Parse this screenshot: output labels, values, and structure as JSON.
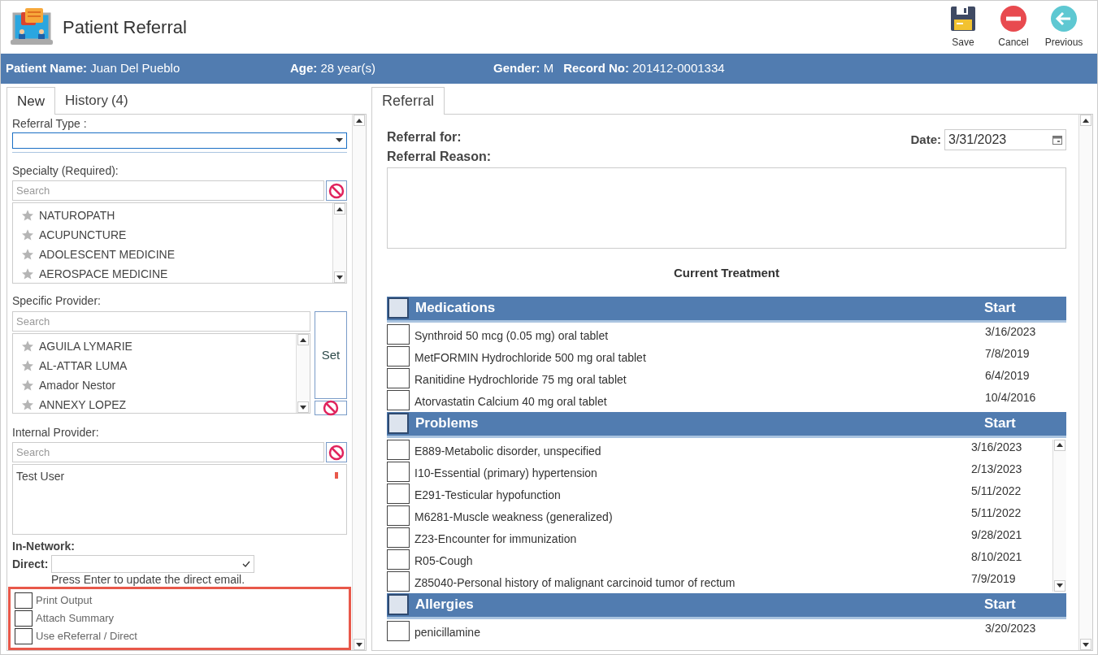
{
  "window": {
    "title": "Patient Referral"
  },
  "toolbar": [
    {
      "kind": "save",
      "label": "Save"
    },
    {
      "kind": "cancel",
      "label": "Cancel"
    },
    {
      "kind": "previous",
      "label": "Previous"
    }
  ],
  "patient_bar": [
    {
      "label": "Patient Name:",
      "value": "Juan Del Pueblo"
    },
    {
      "label": "Age:",
      "value": "28 year(s)"
    },
    {
      "label": "Gender:",
      "value": "M"
    },
    {
      "label": "Record No:",
      "value": "201412-0001334"
    }
  ],
  "left_tabs": [
    {
      "label": "New",
      "selected": true
    },
    {
      "label": "History",
      "count": "(4)",
      "selected": false
    }
  ],
  "referral_type": {
    "label": "Referral Type :"
  },
  "specialty": {
    "label": "Specialty (Required):",
    "search_placeholder": "Search",
    "items": [
      "NATUROPATH",
      "ACUPUNCTURE",
      "ADOLESCENT MEDICINE",
      "AEROSPACE MEDICINE"
    ]
  },
  "specific_provider": {
    "label": "Specific Provider:",
    "search_placeholder": "Search",
    "items": [
      "AGUILA LYMARIE",
      "AL-ATTAR LUMA",
      "Amador Nestor",
      "ANNEXY LOPEZ"
    ],
    "set_button": "Set"
  },
  "internal_provider": {
    "label": "Internal Provider:",
    "search_placeholder": "Search",
    "items": [
      "Test User"
    ]
  },
  "in_network": {
    "label": "In-Network:"
  },
  "direct": {
    "label": "Direct:",
    "hint": "Press Enter to update the direct email."
  },
  "options": [
    {
      "label": "Print Output",
      "checked": false
    },
    {
      "label": "Attach Summary",
      "checked": false
    },
    {
      "label": "Use eReferral / Direct",
      "checked": false
    }
  ],
  "right_tabs": [
    {
      "label": "Referral",
      "selected": true
    }
  ],
  "referral": {
    "referral_for": "Referral for:",
    "date_label": "Date:",
    "date": "3/31/2023",
    "reason_label": "Referral Reason:",
    "current_treatment": "Current Treatment"
  },
  "sections": [
    {
      "title": "Medications",
      "start": "Start",
      "all_checked": false,
      "scroll": false,
      "rows": [
        {
          "name": "Synthroid 50 mcg (0.05 mg) oral tablet",
          "date": "3/16/2023",
          "checked": false
        },
        {
          "name": "MetFORMIN Hydrochloride 500 mg oral tablet",
          "date": "7/8/2019",
          "checked": false
        },
        {
          "name": "Ranitidine Hydrochloride 75 mg oral tablet",
          "date": "6/4/2019",
          "checked": false
        },
        {
          "name": "Atorvastatin Calcium 40 mg oral tablet",
          "date": "10/4/2016",
          "checked": false
        }
      ]
    },
    {
      "title": "Problems",
      "start": "Start",
      "all_checked": false,
      "scroll": true,
      "rows": [
        {
          "name": "E889-Metabolic disorder, unspecified",
          "date": "3/16/2023",
          "checked": false
        },
        {
          "name": "I10-Essential (primary) hypertension",
          "date": "2/13/2023",
          "checked": false
        },
        {
          "name": "E291-Testicular hypofunction",
          "date": "5/11/2022",
          "checked": false
        },
        {
          "name": "M6281-Muscle weakness (generalized)",
          "date": "5/11/2022",
          "checked": false
        },
        {
          "name": "Z23-Encounter for immunization",
          "date": "9/28/2021",
          "checked": false
        },
        {
          "name": "R05-Cough",
          "date": "8/10/2021",
          "checked": false
        },
        {
          "name": "Z85040-Personal history of malignant carcinoid tumor of rectum",
          "date": "7/9/2019",
          "checked": false
        }
      ]
    },
    {
      "title": "Allergies",
      "start": "Start",
      "all_checked": false,
      "scroll": false,
      "rows": [
        {
          "name": "penicillamine",
          "date": "3/20/2023",
          "checked": false
        }
      ]
    }
  ]
}
